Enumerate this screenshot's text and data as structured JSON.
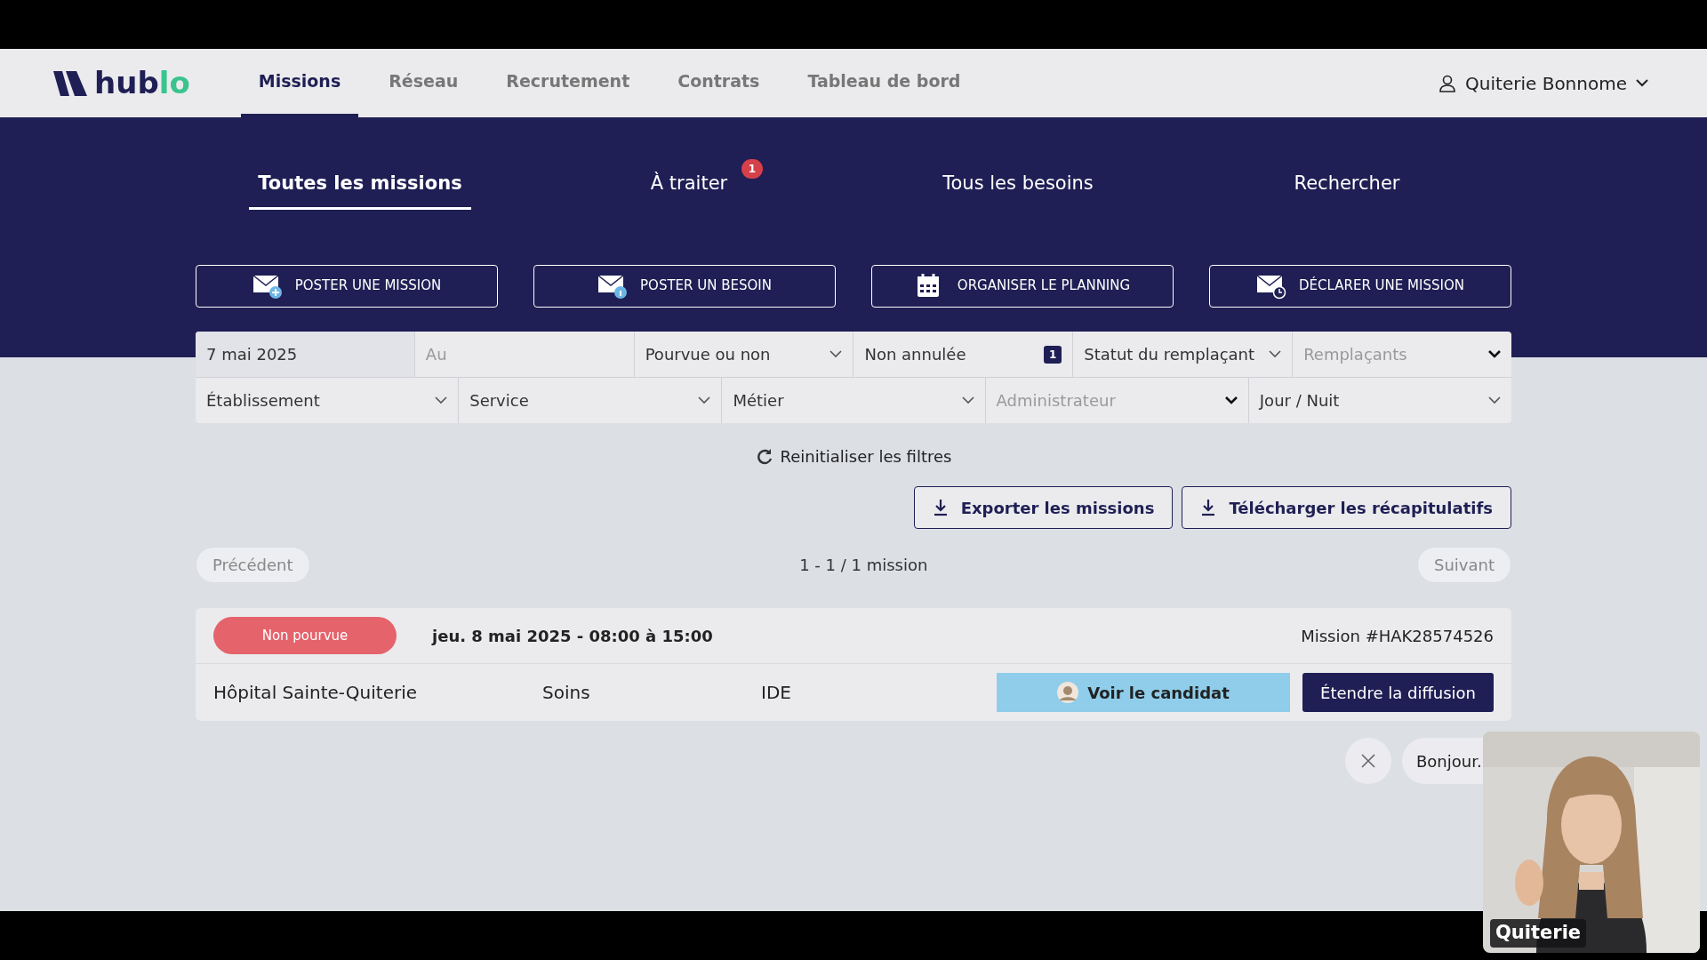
{
  "nav": {
    "logo": [
      {
        "text": "hub",
        "accent": false
      },
      {
        "text": "lo",
        "accent": true
      }
    ],
    "items": [
      {
        "label": "Missions",
        "selected": true
      },
      {
        "label": "Réseau",
        "selected": false
      },
      {
        "label": "Recrutement",
        "selected": false
      },
      {
        "label": "Contrats",
        "selected": false
      },
      {
        "label": "Tableau de bord",
        "selected": false
      }
    ],
    "user": "Quiterie Bonnome"
  },
  "tabs": [
    {
      "label": "Toutes les missions",
      "selected": true
    },
    {
      "label": "À traiter",
      "selected": false,
      "badge": "1"
    },
    {
      "label": "Tous les besoins",
      "selected": false
    },
    {
      "label": "Rechercher",
      "selected": false
    }
  ],
  "actions": [
    {
      "label": "POSTER UNE MISSION",
      "kind": "mail-plus"
    },
    {
      "label": "POSTER UN BESOIN",
      "kind": "mail-info"
    },
    {
      "label": "ORGANISER LE PLANNING",
      "kind": "calendar"
    },
    {
      "label": "DÉCLARER UNE MISSION",
      "kind": "mail-clock"
    }
  ],
  "filters": [
    [
      {
        "kind": "date",
        "value": "7 mai 2025"
      },
      {
        "kind": "date",
        "placeholder": "Au"
      },
      {
        "kind": "select",
        "value": "Pourvue ou non"
      },
      {
        "kind": "select",
        "value": "Non annulée",
        "badge": "1"
      },
      {
        "kind": "select",
        "value": "Statut du remplaçant"
      },
      {
        "kind": "select",
        "placeholder": "Remplaçants"
      }
    ],
    [
      {
        "kind": "select",
        "value": "Établissement"
      },
      {
        "kind": "select",
        "value": "Service"
      },
      {
        "kind": "select",
        "value": "Métier"
      },
      {
        "kind": "select",
        "placeholder": "Administrateur"
      },
      {
        "kind": "select",
        "value": "Jour / Nuit"
      }
    ]
  ],
  "reset": "Reinitialiser les filtres",
  "exports": [
    "Exporter les missions",
    "Télécharger les récapitulatifs"
  ],
  "pagination": {
    "previous": "Précédent",
    "count": "1 - 1 / 1 mission",
    "next": "Suivant"
  },
  "missions": [
    {
      "status": "Non pourvue",
      "color": "#e5636b",
      "date": "jeu. 8 mai 2025 - 08:00 à 15:00",
      "ref": "Mission #HAK28574526",
      "establishment": "Hôpital Sainte-Quiterie",
      "service": "Soins",
      "job": "IDE",
      "candidate_button": "Voir le candidat",
      "extend_button": "Étendre la diffusion"
    }
  ],
  "chat": {
    "message": "Bonjour."
  },
  "video": {
    "kind": "picture",
    "name": "Quiterie"
  }
}
